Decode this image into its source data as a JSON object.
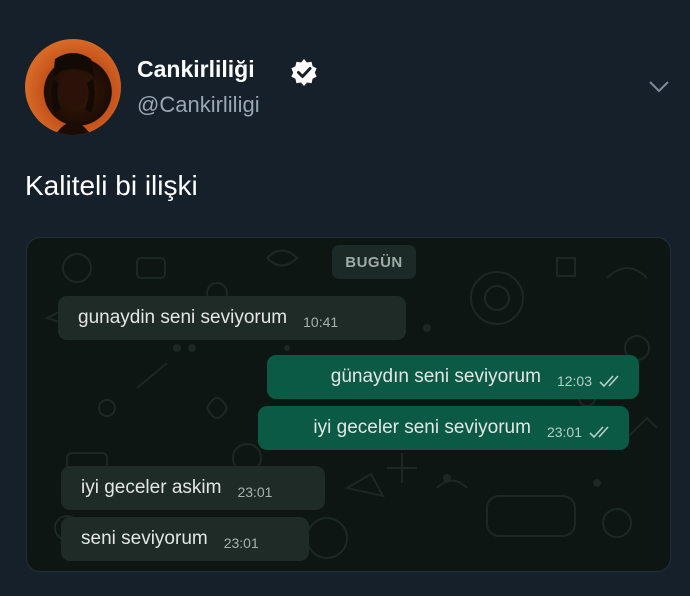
{
  "tweet": {
    "display_name": "Cankirliliği",
    "handle": "@Cankirliligi",
    "text": "Kaliteli bi ilişki",
    "icons": {
      "verified": "verified-badge-icon",
      "menu": "chevron-down-icon",
      "read_receipt": "double-check-icon"
    }
  },
  "chat": {
    "date_label": "BUGÜN",
    "messages": [
      {
        "text": "gunaydin seni seviyorum",
        "time": "10:41",
        "direction": "incoming"
      },
      {
        "text": "günaydın seni seviyorum",
        "time": "12:03",
        "direction": "outgoing"
      },
      {
        "text": "iyi geceler seni seviyorum",
        "time": "23:01",
        "direction": "outgoing"
      },
      {
        "text": "iyi geceler askim",
        "time": "23:01",
        "direction": "incoming"
      },
      {
        "text": "seni seviyorum",
        "time": "23:01",
        "direction": "incoming"
      }
    ]
  },
  "colors": {
    "background": "#15202b",
    "incoming_bubble": "#1f2b27",
    "outgoing_bubble": "#0a5a46",
    "handle": "#9aa6b2"
  }
}
